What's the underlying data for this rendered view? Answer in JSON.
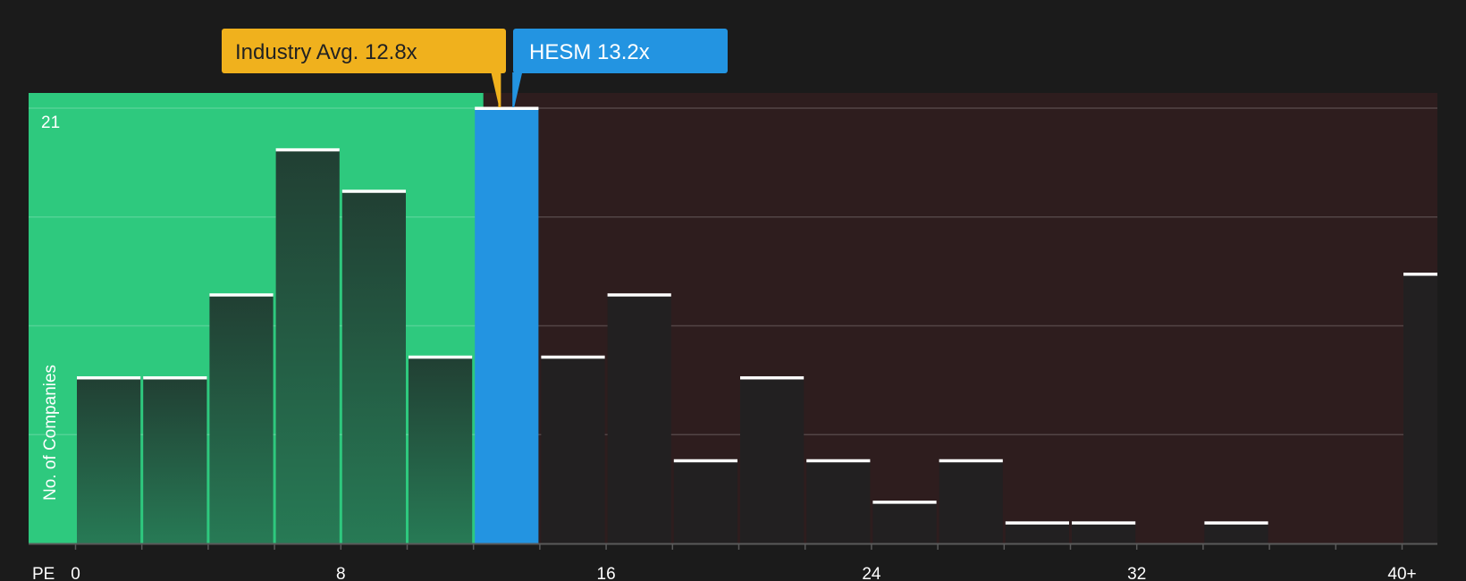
{
  "chart_data": {
    "type": "bar",
    "xlabel": "PE",
    "ylabel": "No. of Companies",
    "xlim": [
      -1.5,
      41.5
    ],
    "ylim": [
      0,
      21
    ],
    "y_tick_labels": [
      {
        "value": 21,
        "label": "21"
      }
    ],
    "x_ticks": [
      {
        "value": 0,
        "label": "0"
      },
      {
        "value": 8,
        "label": "8"
      },
      {
        "value": 16,
        "label": "16"
      },
      {
        "value": 24,
        "label": "24"
      },
      {
        "value": 32,
        "label": "32"
      },
      {
        "value": 40,
        "label": "40+"
      }
    ],
    "bin_width": 2,
    "bins": [
      {
        "start": 0,
        "end": 2,
        "value": 8
      },
      {
        "start": 2,
        "end": 4,
        "value": 8
      },
      {
        "start": 4,
        "end": 6,
        "value": 12
      },
      {
        "start": 6,
        "end": 8,
        "value": 19
      },
      {
        "start": 8,
        "end": 10,
        "value": 17
      },
      {
        "start": 10,
        "end": 12,
        "value": 9
      },
      {
        "start": 12,
        "end": 14,
        "value": 21
      },
      {
        "start": 14,
        "end": 16,
        "value": 9
      },
      {
        "start": 16,
        "end": 18,
        "value": 12
      },
      {
        "start": 18,
        "end": 20,
        "value": 4
      },
      {
        "start": 20,
        "end": 22,
        "value": 8
      },
      {
        "start": 22,
        "end": 24,
        "value": 4
      },
      {
        "start": 24,
        "end": 26,
        "value": 2
      },
      {
        "start": 26,
        "end": 28,
        "value": 4
      },
      {
        "start": 28,
        "end": 30,
        "value": 1
      },
      {
        "start": 30,
        "end": 32,
        "value": 1
      },
      {
        "start": 32,
        "end": 34,
        "value": 0
      },
      {
        "start": 34,
        "end": 36,
        "value": 1
      },
      {
        "start": 36,
        "end": 38,
        "value": 0
      },
      {
        "start": 38,
        "end": 40,
        "value": 0
      },
      {
        "start": 40,
        "end": 42,
        "value": 13
      }
    ],
    "industry_avg": {
      "label": "Industry Avg. 12.8x",
      "value": 12.8
    },
    "company": {
      "label": "HESM 13.2x",
      "value": 13.2
    },
    "grid": true,
    "colors": {
      "background": "#1b1b1b",
      "undervalued_zone": "#2ec97e",
      "overvalued_zone": "#2e1d1e",
      "bar_in_green": "#24493a",
      "bar_in_red": "#222021",
      "company_bar": "#2394e1",
      "industry_label": "#f0b11d",
      "company_label": "#2394e1",
      "bar_cap": "#ffffff",
      "grid_line": "#4a4445",
      "axis": "#5a5a5a"
    }
  }
}
